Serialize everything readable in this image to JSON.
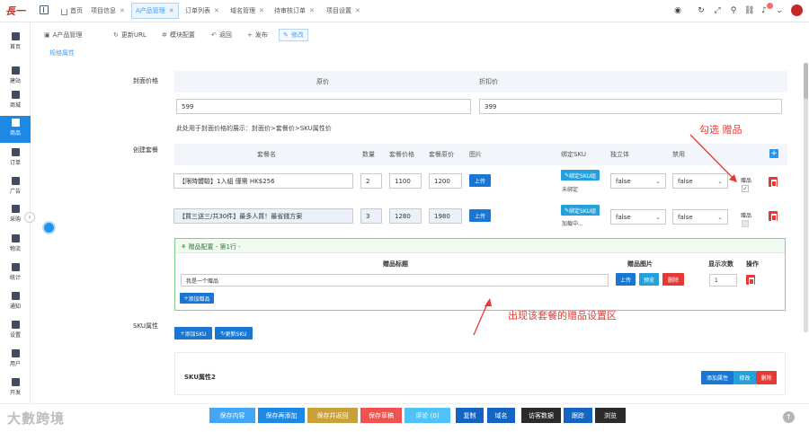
{
  "app": {
    "logo_text": "長一",
    "tabs": [
      {
        "label": "首页",
        "closable": false
      },
      {
        "label": "项目信息",
        "closable": true
      },
      {
        "label": "A产品管理",
        "closable": true,
        "active": true
      },
      {
        "label": "订单列表",
        "closable": true
      },
      {
        "label": "域名管理",
        "closable": true
      },
      {
        "label": "待审核订单",
        "closable": true
      },
      {
        "label": "项目设置",
        "closable": true
      }
    ]
  },
  "sidebar": {
    "items": [
      {
        "label": "首页",
        "icon": "home-icon"
      },
      {
        "label": "建站",
        "icon": "site-icon"
      },
      {
        "label": "商城",
        "icon": "cart-icon"
      },
      {
        "label": "商品",
        "icon": "product-icon",
        "active": true
      },
      {
        "label": "订单",
        "icon": "order-icon"
      },
      {
        "label": "广告",
        "icon": "ad-icon"
      },
      {
        "label": "采购",
        "icon": "truck-icon"
      },
      {
        "label": "物流",
        "icon": "logistics-icon"
      },
      {
        "label": "统计",
        "icon": "chart-icon"
      },
      {
        "label": "通知",
        "icon": "bell-icon"
      },
      {
        "label": "设置",
        "icon": "gear-icon"
      },
      {
        "label": "用户",
        "icon": "user-icon"
      },
      {
        "label": "开发",
        "icon": "code-icon"
      }
    ]
  },
  "toolbar": {
    "items": [
      {
        "label": "A产品管理"
      },
      {
        "label": "更新URL"
      },
      {
        "label": "模块配置"
      },
      {
        "label": "返回"
      },
      {
        "label": "发布"
      },
      {
        "label": "修改"
      }
    ]
  },
  "section": {
    "title": "规格属性"
  },
  "cover_price": {
    "label": "封面价格",
    "original_header": "原价",
    "discount_header": "折扣价",
    "original_value": "599",
    "discount_value": "399",
    "note": "此处用于封面价格的展示：封面价>套餐价>SKU属性价"
  },
  "packages": {
    "label": "创建套餐",
    "headers": {
      "name": "套餐名",
      "qty": "数量",
      "price": "套餐价格",
      "orig": "套餐原价",
      "image": "图片",
      "sku": "绑定SKU",
      "independent": "独立体",
      "disabled": "禁用"
    },
    "rows": [
      {
        "name": "【限時體驗】1入組 僅需 HK$256",
        "qty": "2",
        "price": "1100",
        "orig": "1200",
        "upload": "上传",
        "bind_label": "绑定SKU组",
        "bind_status": "未绑定",
        "independent": "false",
        "disabled": "false",
        "gift_label": "赠品",
        "gift_checked": true
      },
      {
        "name": "【買三送三/共30件】最多人買！最省錢方案",
        "qty": "3",
        "price": "1280",
        "orig": "1980",
        "upload": "上传",
        "bind_label": "绑定SKU组",
        "bind_status": "加载中...",
        "independent": "false",
        "disabled": "false",
        "gift_label": "赠品",
        "gift_checked": false
      }
    ]
  },
  "gift_config": {
    "title": "赠品配置 - 第1行 -",
    "col_title": "赠品标题",
    "col_image": "赠品图片",
    "col_count": "显示次数",
    "col_ops": "操作",
    "row": {
      "title": "我是一个赠品",
      "upload": "上传",
      "preview": "预览",
      "delete": "删除",
      "count": "1"
    },
    "add_label": "添加赠品"
  },
  "sku": {
    "label": "SKU属性",
    "add": "添加SKU",
    "update": "更新SKU",
    "card_title": "SKU属性2",
    "card_add": "添加属性",
    "card_edit": "修改",
    "card_delete": "删除"
  },
  "annotations": {
    "top": "勾选 赠品",
    "bottom": "出现该套餐的赠品设置区"
  },
  "watermark": "大數跨境",
  "bottom_buttons": [
    {
      "label": "保存内容",
      "color": "#42a5f5"
    },
    {
      "label": "保存再添加",
      "color": "#1e88e5"
    },
    {
      "label": "保存并返回",
      "color": "#c9a13b"
    },
    {
      "label": "保存草稿",
      "color": "#ef5350"
    },
    {
      "label": "评论 (0)",
      "color": "#4fc3f7"
    },
    {
      "label": "复制",
      "color": "#1565c0"
    },
    {
      "label": "域名",
      "color": "#1565c0"
    },
    {
      "label": "访客数据",
      "color": "#2b2b2b"
    },
    {
      "label": "跟踪",
      "color": "#1565c0"
    },
    {
      "label": "浏览",
      "color": "#2b2b2b"
    }
  ]
}
